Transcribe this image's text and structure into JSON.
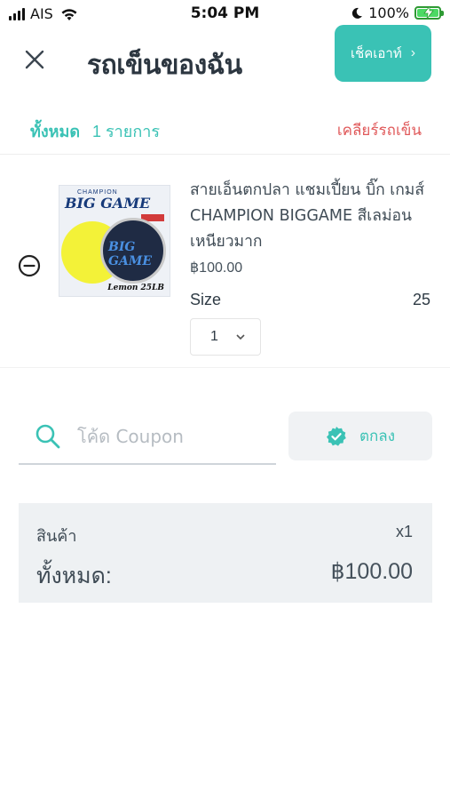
{
  "status_bar": {
    "carrier": "AIS",
    "time": "5:04 PM",
    "battery": "100%"
  },
  "header": {
    "title": "รถเข็นของฉัน",
    "checkout_label": "เช็คเอาท์",
    "checkout_chevron": "›"
  },
  "summary": {
    "all_label": "ทั้งหมด",
    "count_text": "1 รายการ",
    "clear_label": "เคลียร์รถเข็น"
  },
  "item": {
    "image_brand_top": "CHAMPION",
    "image_brand": "BIG GAME",
    "image_spool_text": "BIG GAME",
    "image_label": "Lemon 25LB",
    "name": "สายเอ็นตกปลา แชมเปี้ยน บิ๊ก เกมส์ CHAMPION BIGGAME สีเลม่อน เหนียวมาก",
    "price": "฿100.00",
    "size_label": "Size",
    "size_value": "25",
    "quantity": "1"
  },
  "coupon": {
    "placeholder": "โค้ด Coupon",
    "apply_label": "ตกลง"
  },
  "totals": {
    "products_label": "สินค้า",
    "products_qty": "x1",
    "total_label": "ทั้งหมด:",
    "total_value": "฿100.00"
  },
  "colors": {
    "accent": "#3ac2b5",
    "danger": "#e0595a",
    "panel": "#eef1f3"
  }
}
